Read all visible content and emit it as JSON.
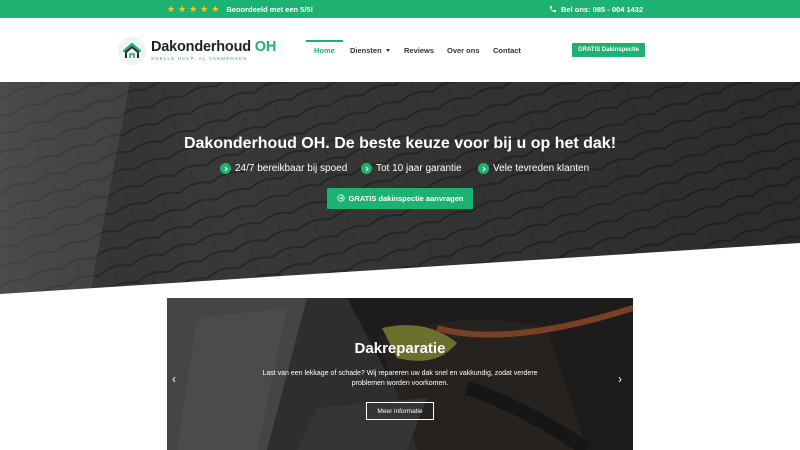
{
  "topbar": {
    "stars": [
      "★",
      "★",
      "★",
      "★",
      "★"
    ],
    "rating_text": "Beoordeeld met een 5/5!",
    "phone_text": "Bel ons: 085 - 004 1432",
    "background": "#1db272",
    "star_color": "#f6c833"
  },
  "header": {
    "logo_name": "Dakonderhoud",
    "logo_name_accent": "OH",
    "logo_tagline": "SNELLE HULP, AL VAKMENSEN",
    "nav": [
      {
        "label": "Home",
        "active": true
      },
      {
        "label": "Diensten",
        "active": false,
        "has_dropdown": true
      },
      {
        "label": "Reviews",
        "active": false
      },
      {
        "label": "Over ons",
        "active": false
      },
      {
        "label": "Contact",
        "active": false
      }
    ],
    "cta_label": "GRATIS Dakinspectie"
  },
  "hero": {
    "title": "Dakonderhoud OH. De beste keuze voor bij u op het dak!",
    "features": [
      "24/7 bereikbaar bij spoed",
      "Tot 10 jaar garantie",
      "Vele tevreden klanten"
    ],
    "button_label": "GRATIS dakinspectie aanvragen"
  },
  "slider": {
    "title": "Dakreparatie",
    "text": "Last van een lekkage of schade? Wij repareren uw dak snel en vakkundig, zodat verdere problemen worden voorkomen.",
    "button_label": "Meer informatie",
    "prev_icon": "‹",
    "next_icon": "›"
  },
  "colors": {
    "accent": "#1db272",
    "text_dark": "#333333"
  }
}
